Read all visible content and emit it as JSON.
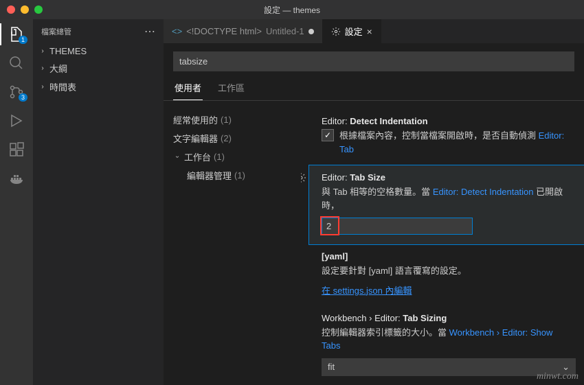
{
  "titlebar": {
    "title": "設定 — themes"
  },
  "activitybar": {
    "explorer_badge": "1",
    "scm_badge": "3"
  },
  "sidebar": {
    "title": "檔案總管",
    "sections": [
      {
        "label": "THEMES"
      },
      {
        "label": "大綱"
      },
      {
        "label": "時間表"
      }
    ]
  },
  "tabs": {
    "file": {
      "label": "<!DOCTYPE html>",
      "subtitle": "Untitled-1"
    },
    "settings": {
      "label": "設定"
    }
  },
  "settings": {
    "search_value": "tabsize",
    "scope": {
      "user": "使用者",
      "workspace": "工作區"
    },
    "toc": {
      "frequently": {
        "label": "經常使用的",
        "count": "(1)"
      },
      "texteditor": {
        "label": "文字編輯器",
        "count": "(2)"
      },
      "workbench": {
        "label": "工作台",
        "count": "(1)"
      },
      "editor_mgmt": {
        "label": "編輯器管理",
        "count": "(1)"
      }
    },
    "detect_indent": {
      "category": "Editor:",
      "name": "Detect Indentation",
      "desc_pre": "根據檔案內容，控制當檔案開啟時，是否自動偵測",
      "link": "Editor: Tab"
    },
    "tab_size": {
      "category": "Editor:",
      "name": "Tab Size",
      "desc_pre": "與 Tab 相等的空格數量。當",
      "link": "Editor: Detect Indentation",
      "desc_post": "已開啟時，",
      "value": "2"
    },
    "yaml": {
      "title": "[yaml]",
      "desc": "設定要針對 [yaml] 語言覆寫的設定。",
      "edit_link": "在 settings.json 內編輯"
    },
    "tab_sizing": {
      "breadcrumb": "Workbench › Editor:",
      "name": "Tab Sizing",
      "desc_pre": "控制編輯器索引標籤的大小。當",
      "link": "Workbench › Editor: Show Tabs",
      "value": "fit"
    }
  },
  "watermark": "minwt.com"
}
